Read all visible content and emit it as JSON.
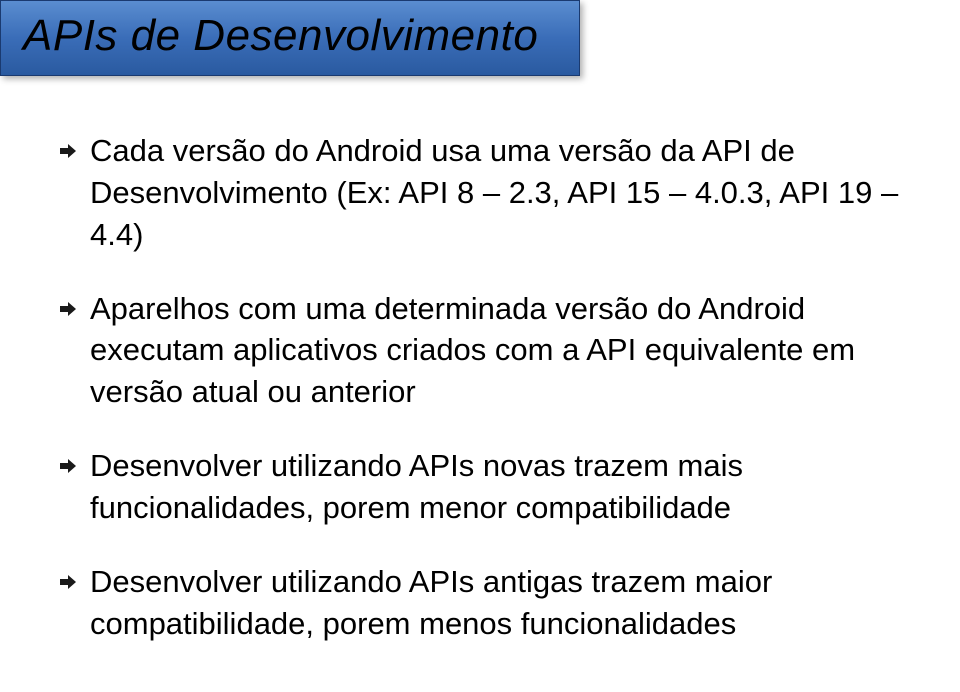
{
  "title": "APIs de Desenvolvimento",
  "bullets": [
    "Cada versão do Android usa uma versão da API de Desenvolvimento (Ex: API 8 – 2.3, API 15 – 4.0.3, API 19 – 4.4)",
    "Aparelhos com uma determinada versão do Android executam aplicativos criados com a API equivalente em versão atual ou anterior",
    "Desenvolver utilizando APIs novas trazem mais funcionalidades, porem menor compatibilidade",
    "Desenvolver utilizando APIs antigas trazem maior compatibilidade, porem menos funcionalidades"
  ],
  "colors": {
    "arrow": "#1a1a1a"
  }
}
